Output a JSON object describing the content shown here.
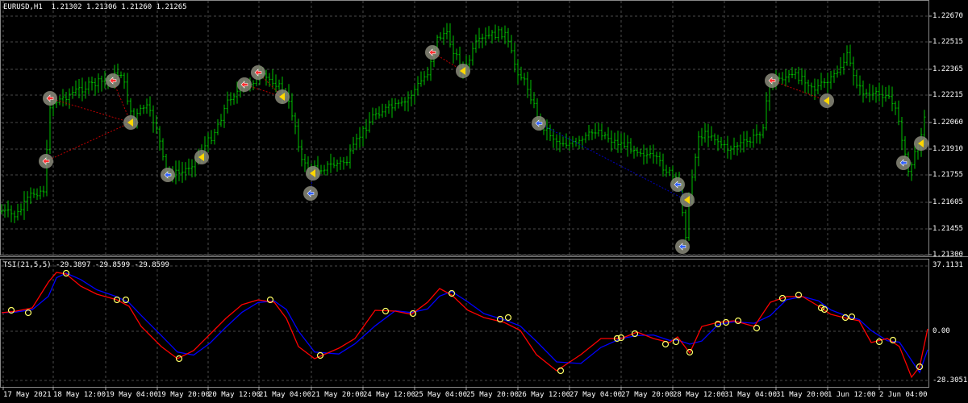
{
  "main_chart": {
    "header": "EURUSD,H1  1.21302 1.21306 1.21260 1.21265",
    "price_labels": [
      "1.22670",
      "1.22515",
      "1.22365",
      "1.22215",
      "1.22060",
      "1.21910",
      "1.21755",
      "1.21605",
      "1.21455",
      "1.21300"
    ],
    "price_min": 1.213,
    "price_max": 1.2267
  },
  "indicator": {
    "header": "TSI(21,5,5) -29.3897 -29.8599 -29.8599",
    "levels": [
      "37.1131",
      "0.00",
      "-28.3051"
    ],
    "level_values": [
      37.1131,
      0.0,
      -28.3051
    ],
    "tsi_color": "#ff0000",
    "signal_color": "#0000ff",
    "marker_color": "#ffff66"
  },
  "time_axis": {
    "labels": [
      "17 May 2021",
      "18 May 12:00",
      "19 May 04:00",
      "19 May 20:00",
      "20 May 12:00",
      "21 May 04:00",
      "21 May 20:00",
      "24 May 12:00",
      "25 May 04:00",
      "25 May 20:00",
      "26 May 12:00",
      "27 May 04:00",
      "27 May 20:00",
      "28 May 12:00",
      "31 May 04:00",
      "31 May 20:00",
      "1 Jun 12:00",
      "2 Jun 04:00"
    ]
  },
  "colors": {
    "background": "#000000",
    "candle": "#00c000",
    "grid": "#4a4a4a",
    "buy_arrow": "#3060ff",
    "sell_arrow": "#ff3030",
    "exit_arrow": "#ffd700",
    "trade_line_sell": "#c00000",
    "trade_line_buy": "#0000c0"
  }
}
